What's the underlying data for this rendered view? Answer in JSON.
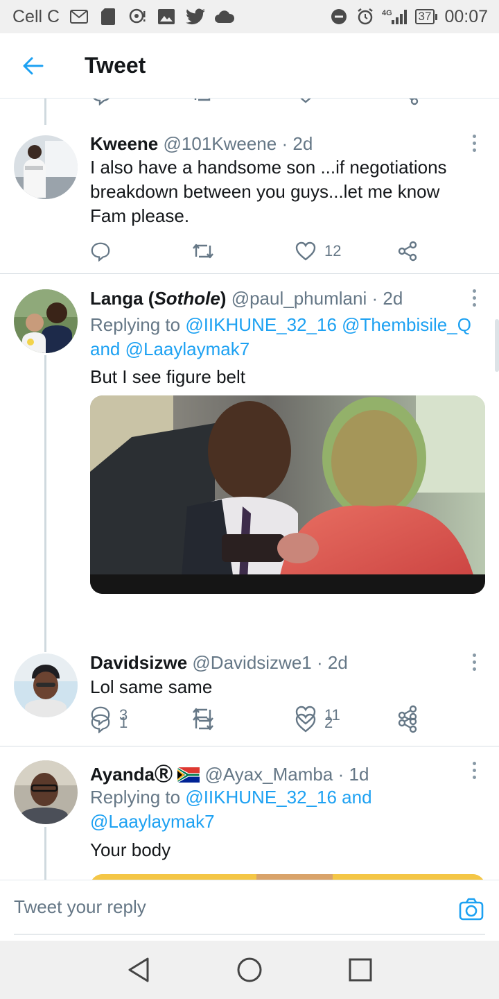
{
  "status_bar": {
    "carrier": "Cell C",
    "network": "4G",
    "battery": "37",
    "time": "00:07"
  },
  "header": {
    "title": "Tweet"
  },
  "tweets": [
    {
      "name": "Kweene",
      "handle": "@101Kweene",
      "separator": "·",
      "time": "2d",
      "text": "I also have a handsome son ...if negotiations breakdown between you guys...let me know Fam please.",
      "reply_count": "",
      "like_count": "12"
    },
    {
      "name_plain": "Langa (",
      "name_italic": "Sothole",
      "name_close": ")",
      "handle": "@paul_phumlani",
      "separator": "·",
      "time": "2d",
      "replying_prefix": "Replying to ",
      "reply_mentions": "@IIKHUNE_32_16 @Thembisile_Q",
      "reply_and": "and ",
      "reply_last": "@Laaylaymak7",
      "text": "But I see figure belt",
      "reply_count": "3",
      "like_count": "11"
    },
    {
      "name": "Davidsizwe",
      "handle": "@Davidsizwe1",
      "separator": "·",
      "time": "2d",
      "text": "Lol same same",
      "reply_count": "1",
      "like_count": "2"
    },
    {
      "name": "Ayanda",
      "name_badge": "Ⓡ",
      "handle": "@Ayax_Mamba",
      "separator": "·",
      "time": "1d",
      "replying_prefix": "Replying to ",
      "reply_mentions": "@IIKHUNE_32_16 and",
      "reply_last": "@Laaylaymak7",
      "text": "Your body"
    }
  ],
  "reply_bar": {
    "placeholder": "Tweet your reply"
  },
  "colors": {
    "accent": "#1da1f2",
    "muted": "#657786",
    "divider": "#d6dde2",
    "status_bar_bg": "#f0f0f0"
  },
  "icons": [
    "gmail-icon",
    "sd-card-icon",
    "chat-icon",
    "gallery-icon",
    "twitter-icon",
    "cloud-icon",
    "dnd-icon",
    "alarm-icon",
    "signal-icon",
    "back-arrow-icon",
    "reply-icon",
    "retweet-icon",
    "like-icon",
    "share-icon",
    "more-icon",
    "camera-icon",
    "nav-back-icon",
    "nav-home-icon",
    "nav-recents-icon"
  ]
}
